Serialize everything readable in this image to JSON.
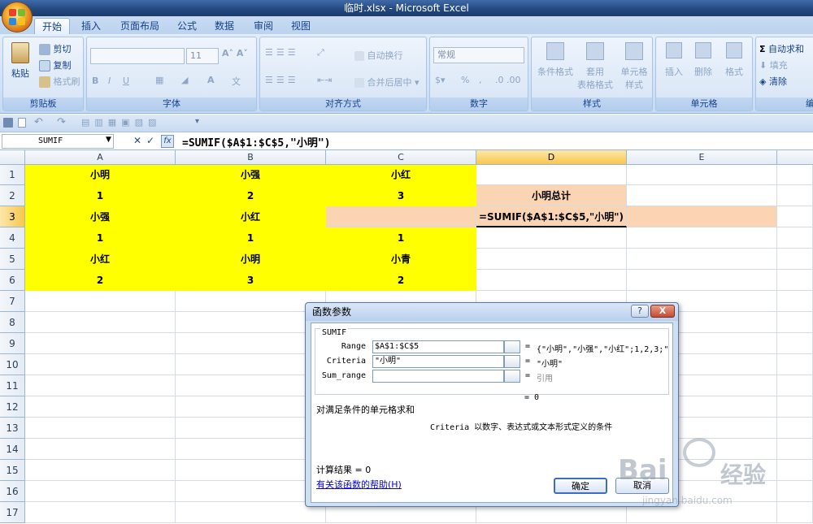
{
  "window": {
    "title": "临时.xlsx - Microsoft Excel"
  },
  "tabs": [
    "开始",
    "插入",
    "页面布局",
    "公式",
    "数据",
    "审阅",
    "视图"
  ],
  "ribbon": {
    "clipboard": {
      "paste": "粘贴",
      "cut": "剪切",
      "copy": "复制",
      "format_painter": "格式刷",
      "label": "剪贴板"
    },
    "font": {
      "size": "11",
      "label": "字体"
    },
    "alignment": {
      "wrap": "自动换行",
      "merge": "合并后居中",
      "label": "对齐方式"
    },
    "number": {
      "format": "常规",
      "label": "数字"
    },
    "styles": {
      "conditional": "条件格式",
      "table_format_1": "套用",
      "table_format_2": "表格格式",
      "cell_style_1": "单元格",
      "cell_style_2": "样式",
      "label": "样式"
    },
    "cells": {
      "insert": "插入",
      "delete": "删除",
      "format": "格式",
      "label": "单元格"
    },
    "editing": {
      "autosum": "自动求和",
      "fill": "填充",
      "clear": "清除",
      "label": "编"
    }
  },
  "formula_bar": {
    "name_box": "SUMIF",
    "fx": "fx",
    "formula": "=SUMIF($A$1:$C$5,\"小明\")"
  },
  "columns": [
    "A",
    "B",
    "C",
    "D",
    "E"
  ],
  "rows": [
    "1",
    "2",
    "3",
    "4",
    "5",
    "6",
    "7",
    "8",
    "9",
    "10",
    "11",
    "12",
    "13",
    "14",
    "15",
    "16",
    "17"
  ],
  "grid": {
    "r1": [
      "小明",
      "小强",
      "小红"
    ],
    "r2": [
      "1",
      "2",
      "3"
    ],
    "r3": [
      "小强",
      "小红",
      ""
    ],
    "r4": [
      "1",
      "1",
      "1"
    ],
    "r5": [
      "小红",
      "小明",
      "小青"
    ],
    "r6": [
      "2",
      "3",
      "2"
    ],
    "d2": "小明总计",
    "d3": "=SUMIF($A$1:$C$5,\"小明\")"
  },
  "dialog": {
    "title": "函数参数",
    "help_btn": "?",
    "close_btn": "X",
    "function_name": "SUMIF",
    "params": [
      {
        "label": "Range",
        "value": "$A$1:$C$5",
        "result": "{\"小明\",\"小强\",\"小红\";1,2,3;\"小"
      },
      {
        "label": "Criteria",
        "value": "\"小明\"",
        "result": "\"小明\""
      },
      {
        "label": "Sum_range",
        "value": "",
        "result": "引用"
      }
    ],
    "eq": "=",
    "total_result": "= 0",
    "description": "对满足条件的单元格求和",
    "param_help": "Criteria  以数字、表达式或文本形式定义的条件",
    "calc_result": "计算结果 = 0",
    "help_link": "有关该函数的帮助(H)",
    "ok": "确定",
    "cancel": "取消"
  },
  "watermark": {
    "brand": "Bai",
    "brand2": "经验",
    "url": "jingyan.baidu.com"
  }
}
